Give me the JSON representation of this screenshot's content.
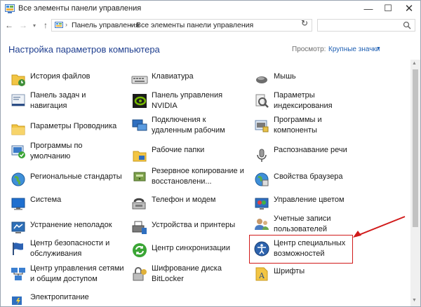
{
  "window": {
    "title": "Все элементы панели управления",
    "controls": {
      "minimize": "—",
      "maximize": "☐",
      "close": "✕"
    }
  },
  "navigation": {
    "back": "←",
    "forward": "→",
    "recent": "▾",
    "up": "↑",
    "breadcrumbs": [
      "Панель управления",
      "Все элементы панели управления"
    ],
    "separator": "›",
    "dropdown": "▾",
    "refresh": "↻",
    "search_placeholder": ""
  },
  "header": {
    "title": "Настройка параметров компьютера",
    "view_label": "Просмотр:",
    "view_value": "Крупные значки",
    "view_dropdown": "▼"
  },
  "columns": [
    [
      {
        "label": "История файлов",
        "icon": "file-history-icon"
      },
      {
        "label": "Панель задач и\nнавигация",
        "icon": "taskbar-icon"
      },
      {
        "label": "Параметры Проводника",
        "icon": "folder-options-icon"
      },
      {
        "label": "Программы по\nумолчанию",
        "icon": "default-programs-icon"
      },
      {
        "label": "Региональные стандарты",
        "icon": "region-icon"
      },
      {
        "label": "Система",
        "icon": "system-icon"
      },
      {
        "label": "Устранение неполадок",
        "icon": "troubleshooting-icon"
      },
      {
        "label": "Центр безопасности и\nобслуживания",
        "icon": "security-flag-icon"
      },
      {
        "label": "Центр управления сетями\nи общим доступом",
        "icon": "network-icon"
      },
      {
        "label": "Электропитание",
        "icon": "power-icon"
      }
    ],
    [
      {
        "label": "Клавиатура",
        "icon": "keyboard-icon"
      },
      {
        "label": "Панель управления\nNVIDIA",
        "icon": "nvidia-icon"
      },
      {
        "label": "Подключения к\nудаленным рабочим",
        "icon": "remote-desktop-icon"
      },
      {
        "label": "Рабочие папки",
        "icon": "work-folders-icon"
      },
      {
        "label": "Резервное копирование и\nвосстановлени...",
        "icon": "backup-icon"
      },
      {
        "label": "Телефон и модем",
        "icon": "phone-modem-icon"
      },
      {
        "label": "Устройства и принтеры",
        "icon": "devices-printers-icon"
      },
      {
        "label": "Центр синхронизации",
        "icon": "sync-center-icon"
      },
      {
        "label": "Шифрование диска\nBitLocker",
        "icon": "bitlocker-icon"
      }
    ],
    [
      {
        "label": "Мышь",
        "icon": "mouse-icon"
      },
      {
        "label": "Параметры\nиндексирования",
        "icon": "indexing-icon"
      },
      {
        "label": "Программы и\nкомпоненты",
        "icon": "programs-features-icon"
      },
      {
        "label": "Распознавание речи",
        "icon": "speech-recognition-icon"
      },
      {
        "label": "Свойства браузера",
        "icon": "internet-options-icon"
      },
      {
        "label": "Управление цветом",
        "icon": "color-management-icon"
      },
      {
        "label": "Учетные записи\nпользователей",
        "icon": "user-accounts-icon"
      },
      {
        "label": "Центр специальных\nвозможностей",
        "icon": "ease-of-access-icon"
      },
      {
        "label": "Шрифты",
        "icon": "fonts-icon"
      }
    ]
  ],
  "colors": {
    "link_blue": "#1e3e8f",
    "highlight_red": "#d11a1a"
  }
}
